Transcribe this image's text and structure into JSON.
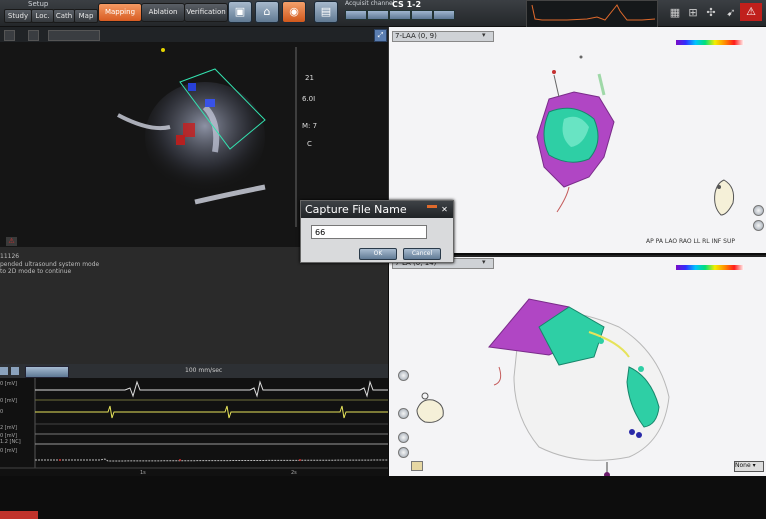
{
  "toolbar": {
    "setup_label": "Setup",
    "setup_tabs": [
      "Study",
      "Loc.",
      "Cath",
      "Map"
    ],
    "modes": [
      {
        "label": "Mapping",
        "active": true
      },
      {
        "label": "Ablation",
        "active": false
      },
      {
        "label": "Verification",
        "active": false
      }
    ],
    "tool_icons": [
      "image-icon",
      "bookmark-icon",
      "camera-icon",
      "print-icon"
    ],
    "cs_label": "Acquisit channel",
    "cs_value": "CS 1-2",
    "right_icons": [
      "grid-icon",
      "zoom-icon",
      "cursor-icon",
      "warning-icon"
    ]
  },
  "ultrasound": {
    "right_labels": [
      "21",
      "6.0I",
      "M: 7",
      "C"
    ]
  },
  "messages": {
    "lines": [
      "11126",
      "pended ultrasound system mode",
      "to 2D mode to continue"
    ]
  },
  "ecg": {
    "speed": "100 mm/sec",
    "channel_labels": [
      "0 [mV]",
      "0 [mV]",
      "0",
      "2 [mV]",
      "0 [mV]",
      "1.2 [NC]",
      "0 [mV]"
    ],
    "time_ticks": [
      "1s",
      "2s"
    ]
  },
  "view_top": {
    "title": "7-LAA (0, 9)",
    "orient_labels": "AP  PA  LAO  RAO  LL  RL  INF  SUP"
  },
  "view_bottom": {
    "title": "7-LA (0, 14)",
    "view_select": "None"
  },
  "dialog": {
    "title": "Capture File Name",
    "input_value": "66",
    "ok_label": "OK",
    "cancel_label": "Cancel"
  },
  "colors": {
    "active_tab": "#e06a2c",
    "map_purple": "#b046c4",
    "map_teal": "#2ecfa5",
    "ecg_yellow": "#e6e35a"
  }
}
